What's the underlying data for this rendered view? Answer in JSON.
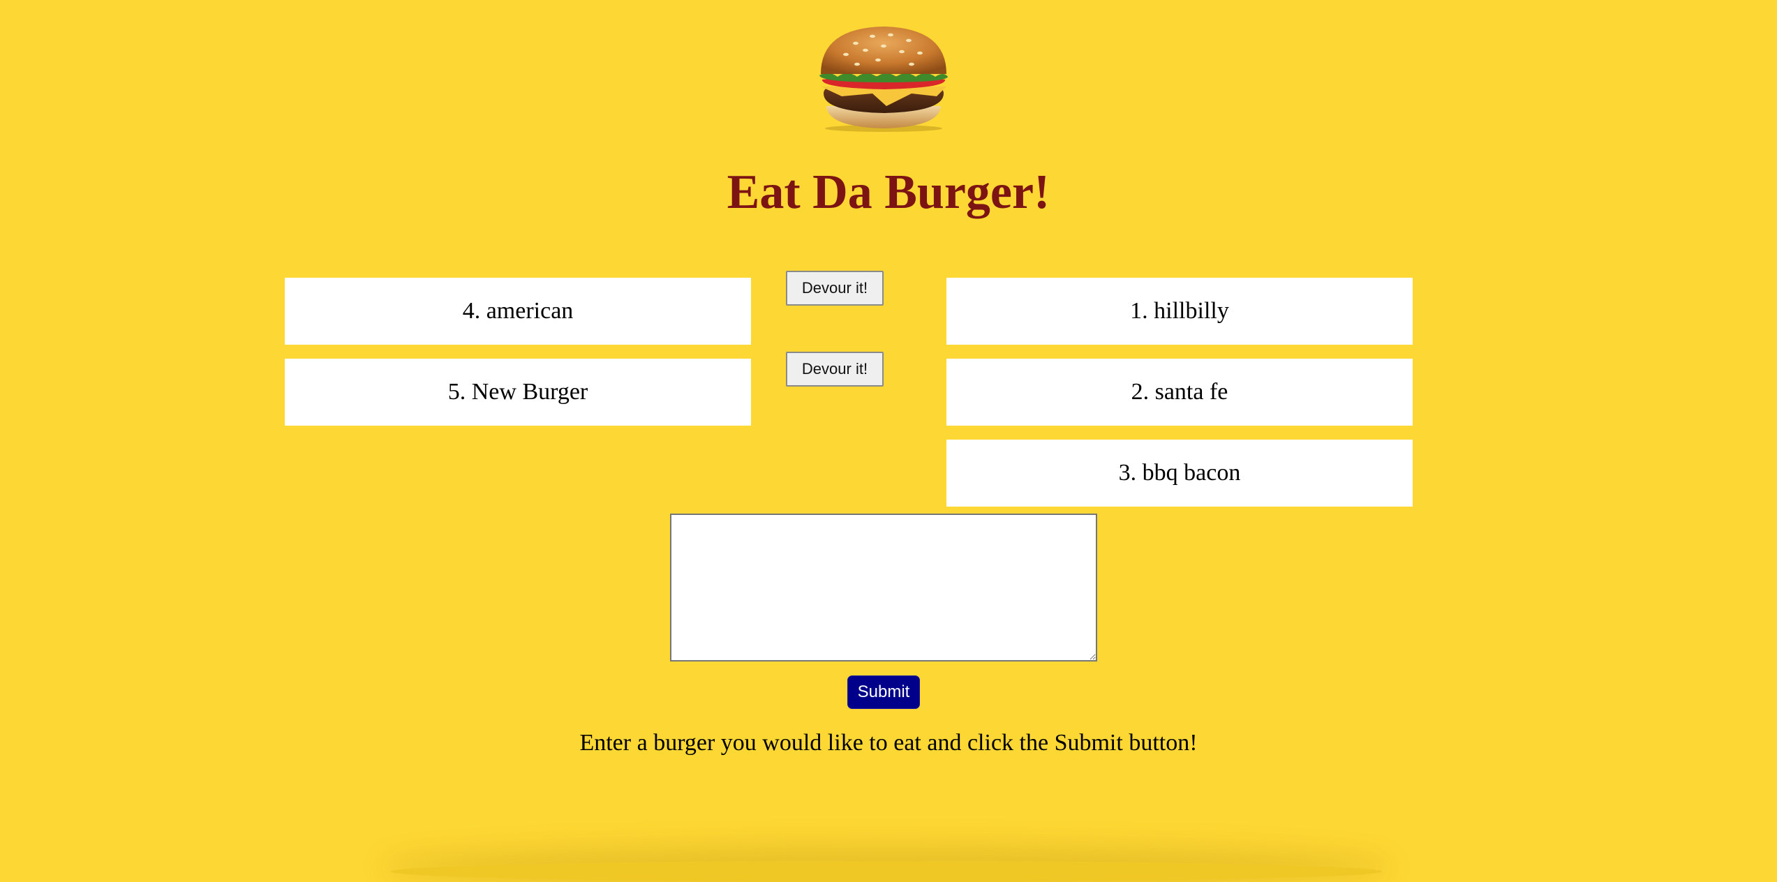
{
  "page": {
    "title": "Eat Da Burger!",
    "background_color": "#fdd733",
    "title_color": "#7d1414"
  },
  "logo": {
    "icon": "burger-icon"
  },
  "uneaten_burgers": [
    {
      "label": "4. american",
      "button_label": "Devour it!"
    },
    {
      "label": "5. New Burger",
      "button_label": "Devour it!"
    }
  ],
  "devoured_burgers": [
    {
      "label": "1. hillbilly"
    },
    {
      "label": "2. santa fe"
    },
    {
      "label": "3. bbq bacon"
    }
  ],
  "form": {
    "textarea_value": "",
    "submit_label": "Submit",
    "submit_color": "#00008b",
    "instructions": "Enter a burger you would like to eat and click the Submit button!"
  }
}
